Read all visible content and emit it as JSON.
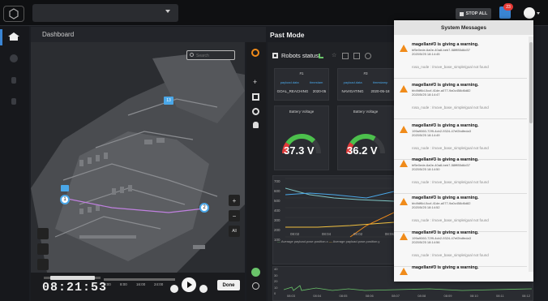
{
  "header": {
    "stop_all": "STOP ALL",
    "notification_count": "23"
  },
  "nav": {
    "dashboard": "Dashboard",
    "past_mode": "Past Mode"
  },
  "map": {
    "search_placeholder": "Search",
    "waypoint_labels": [
      "1",
      "2",
      "13"
    ],
    "zoom_in": "+",
    "zoom_out": "−",
    "zoom_all": "All"
  },
  "playback": {
    "time": "08:21:53",
    "ticks": [
      "0:00",
      "8:00",
      "16:00",
      "24:00"
    ],
    "done": "Done"
  },
  "robots": {
    "title": "Robots status",
    "columns": [
      {
        "id": "#1",
        "headers": [
          "payload.data",
          "timestam"
        ],
        "values": [
          "GOAL_REACHING",
          "2020-05"
        ]
      },
      {
        "id": "#3",
        "headers": [
          "payload.data",
          "timestamp"
        ],
        "values": [
          "NAVIGATING",
          "2020-05-18"
        ]
      }
    ],
    "battery_label": "Battery Voltage",
    "battery": [
      "37.3 V",
      "36.2 V"
    ],
    "chart_y_ticks": [
      "700",
      "600",
      "500",
      "400",
      "300",
      "200",
      "100"
    ],
    "chart_x_ticks": [
      "08:02",
      "08:04",
      "08:02",
      "08:06"
    ],
    "legend": [
      "Average payload.pose.position.x",
      "Average payload.pose.position.y"
    ],
    "mini_y_ticks": [
      "40",
      "30",
      "20",
      "10",
      "0"
    ],
    "mini_x_ticks": [
      "08:03",
      "08:04",
      "08:05",
      "08:06",
      "08:07",
      "08:08",
      "08:09",
      "08:10",
      "08:11",
      "08:12"
    ]
  },
  "messages": {
    "title": "System Messages",
    "items": [
      {
        "title": "magellan#3 is giving a warning.",
        "id": "bf5e0ede-6a0e-40a8-beb7-58fff85d6d37",
        "date": "2020/5/25 18:14:45",
        "body": "rosa_node : /move_base_simple/goal not found"
      },
      {
        "title": "magellan#3 is giving a warning.",
        "id": "bb4fdf6d-0ccf-41de-a077-9a0c458d6d82",
        "date": "2020/5/25 18:14:47",
        "body": "rosa_node : /move_base_simple/goal not found"
      },
      {
        "title": "magellan#3 is giving a warning.",
        "id": "199a9060-72f9-4cb2-9324-47ef2bdfeda3",
        "date": "2020/5/25 18:14:49",
        "body": "rosa_node : /move_base_simple/goal not found"
      },
      {
        "title": "magellan#3 is giving a warning.",
        "id": "bf5e0ede-6a0e-40a8-beb7-58fff85d6d37",
        "date": "2020/5/25 18:14:50",
        "body": "rosa_node : /move_base_simple/goal not found"
      },
      {
        "title": "magellan#3 is giving a warning.",
        "id": "bb4fdf6d-0ccf-41de-a077-9a0c458d6d82",
        "date": "2020/5/25 18:14:52",
        "body": "rosa_node : /move_base_simple/goal not found"
      },
      {
        "title": "magellan#3 is giving a warning.",
        "id": "199a9060-72f9-4cb2-9324-47ef2bdfeda3",
        "date": "2020/5/25 18:14:56",
        "body": "rosa_node : /move_base_simple/goal not found"
      },
      {
        "title": "magellan#3 is giving a warning."
      }
    ]
  }
}
